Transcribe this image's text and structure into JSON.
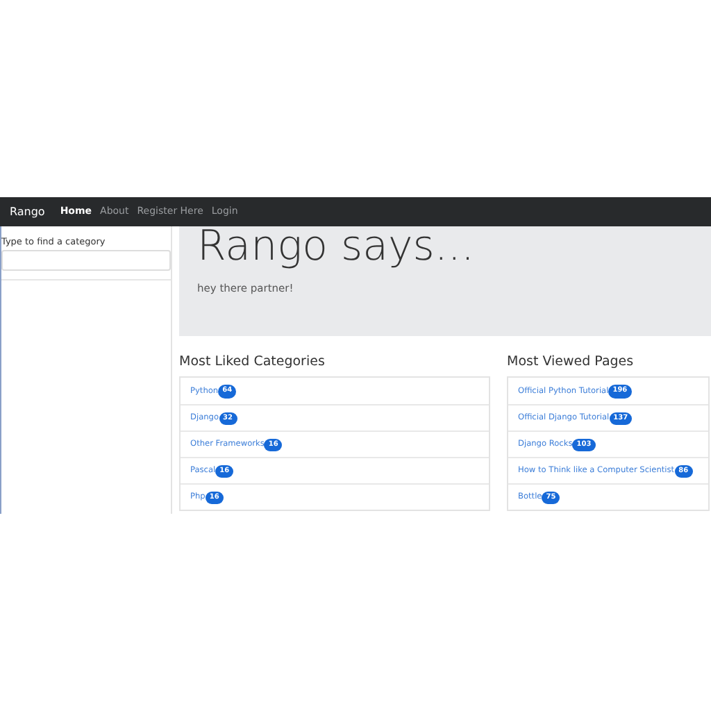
{
  "navbar": {
    "brand": "Rango",
    "links": [
      {
        "label": "Home",
        "selected": true
      },
      {
        "label": "About",
        "selected": false
      },
      {
        "label": "Register Here",
        "selected": false
      },
      {
        "label": "Login",
        "selected": false
      }
    ]
  },
  "sidebar": {
    "label": "Type to find a category"
  },
  "jumbotron": {
    "title": "Rango says...",
    "text": "hey there partner!"
  },
  "panels": [
    {
      "title": "Most Liked Categories",
      "items": [
        {
          "label": "Python",
          "count": "64"
        },
        {
          "label": "Django",
          "count": "32"
        },
        {
          "label": "Other Frameworks",
          "count": "16"
        },
        {
          "label": "Pascal",
          "count": "16"
        },
        {
          "label": "Php",
          "count": "16"
        }
      ]
    },
    {
      "title": "Most Viewed Pages",
      "items": [
        {
          "label": "Official Python Tutorial",
          "count": "196"
        },
        {
          "label": "Official Django Tutorial",
          "count": "137"
        },
        {
          "label": "Django Rocks",
          "count": "103"
        },
        {
          "label": "How to Think like a Computer Scientist",
          "count": "86"
        },
        {
          "label": "Bottle",
          "count": "75"
        }
      ]
    }
  ]
}
